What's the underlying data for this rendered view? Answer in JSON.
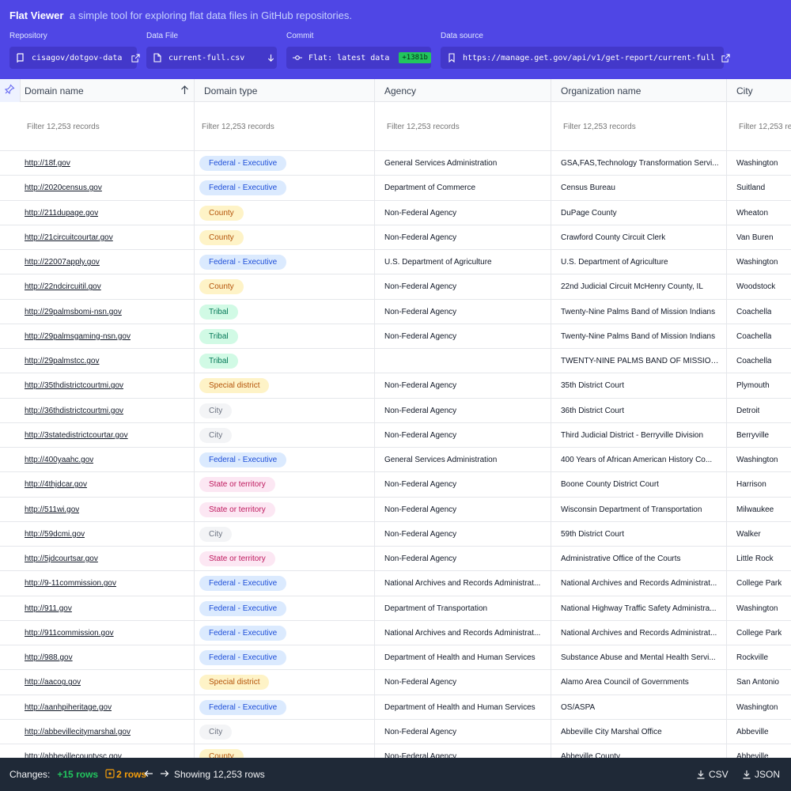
{
  "header": {
    "app_name": "Flat Viewer",
    "tagline": "a simple tool for exploring flat data files in GitHub repositories.",
    "repository": {
      "label": "Repository",
      "value": "cisagov/dotgov-data"
    },
    "data_file": {
      "label": "Data File",
      "value": "current-full.csv"
    },
    "commit": {
      "label": "Commit",
      "value": "Flat: latest data",
      "badge": "+1381b"
    },
    "data_source": {
      "label": "Data source",
      "value": "https://manage.get.gov/api/v1/get-report/current-full"
    }
  },
  "table": {
    "columns": [
      "Domain name",
      "Domain type",
      "Agency",
      "Organization name",
      "City"
    ],
    "filter_placeholder": "Filter 12,253 records",
    "rows": [
      [
        "http://18f.gov",
        "Federal - Executive",
        "General Services Administration",
        "GSA,FAS,Technology Transformation Servi...",
        "Washington"
      ],
      [
        "http://2020census.gov",
        "Federal - Executive",
        "Department of Commerce",
        "Census Bureau",
        "Suitland"
      ],
      [
        "http://211dupage.gov",
        "County",
        "Non-Federal Agency",
        "DuPage County",
        "Wheaton"
      ],
      [
        "http://21circuitcourtar.gov",
        "County",
        "Non-Federal Agency",
        "Crawford County Circuit Clerk",
        "Van Buren"
      ],
      [
        "http://22007apply.gov",
        "Federal - Executive",
        "U.S. Department of Agriculture",
        "U.S. Department of Agriculture",
        "Washington"
      ],
      [
        "http://22ndcircuitil.gov",
        "County",
        "Non-Federal Agency",
        "22nd Judicial Circuit McHenry County, IL",
        "Woodstock"
      ],
      [
        "http://29palmsbomi-nsn.gov",
        "Tribal",
        "Non-Federal Agency",
        "Twenty-Nine Palms Band of Mission Indians",
        "Coachella"
      ],
      [
        "http://29palmsgaming-nsn.gov",
        "Tribal",
        "Non-Federal Agency",
        "Twenty-Nine Palms Band of Mission Indians",
        "Coachella"
      ],
      [
        "http://29palmstcc.gov",
        "Tribal",
        "",
        "TWENTY-NINE PALMS BAND OF MISSION ...",
        "Coachella"
      ],
      [
        "http://35thdistrictcourtmi.gov",
        "Special district",
        "Non-Federal Agency",
        "35th District Court",
        "Plymouth"
      ],
      [
        "http://36thdistrictcourtmi.gov",
        "City",
        "Non-Federal Agency",
        "36th District Court",
        "Detroit"
      ],
      [
        "http://3statedistrictcourtar.gov",
        "City",
        "Non-Federal Agency",
        "Third Judicial District - Berryville Division",
        "Berryville"
      ],
      [
        "http://400yaahc.gov",
        "Federal - Executive",
        "General Services Administration",
        "400 Years of African American History Co...",
        "Washington"
      ],
      [
        "http://4thjdcar.gov",
        "State or territory",
        "Non-Federal Agency",
        "Boone County District Court",
        "Harrison"
      ],
      [
        "http://511wi.gov",
        "State or territory",
        "Non-Federal Agency",
        "Wisconsin Department of Transportation",
        "Milwaukee"
      ],
      [
        "http://59dcmi.gov",
        "City",
        "Non-Federal Agency",
        "59th District Court",
        "Walker"
      ],
      [
        "http://5jdcourtsar.gov",
        "State or territory",
        "Non-Federal Agency",
        "Administrative Office of the Courts",
        "Little Rock"
      ],
      [
        "http://9-11commission.gov",
        "Federal - Executive",
        "National Archives and Records Administrat...",
        "National Archives and Records Administrat...",
        "College Park"
      ],
      [
        "http://911.gov",
        "Federal - Executive",
        "Department of Transportation",
        "National Highway Traffic Safety Administra...",
        "Washington"
      ],
      [
        "http://911commission.gov",
        "Federal - Executive",
        "National Archives and Records Administrat...",
        "National Archives and Records Administrat...",
        "College Park"
      ],
      [
        "http://988.gov",
        "Federal - Executive",
        "Department of Health and Human Services",
        "Substance Abuse and Mental Health Servi...",
        "Rockville"
      ],
      [
        "http://aacog.gov",
        "Special district",
        "Non-Federal Agency",
        "Alamo Area Council of Governments",
        "San Antonio"
      ],
      [
        "http://aanhpiheritage.gov",
        "Federal - Executive",
        "Department of Health and Human Services",
        "OS/ASPA",
        "Washington"
      ],
      [
        "http://abbevillecitymarshal.gov",
        "City",
        "Non-Federal Agency",
        "Abbeville City Marshal Office",
        "Abbeville"
      ],
      [
        "http://abbevillecountysc.gov",
        "County",
        "Non-Federal Agency",
        "Abbeville County",
        "Abbeville"
      ]
    ],
    "type_colors": {
      "Federal - Executive": "t-fed",
      "County": "t-county",
      "Tribal": "t-tribal",
      "Special district": "t-special",
      "City": "t-city",
      "State or territory": "t-state"
    }
  },
  "footer": {
    "changes_label": "Changes:",
    "added": "+15 rows",
    "modified": "2 rows",
    "showing": "Showing 12,253 rows",
    "csv": "CSV",
    "json": "JSON"
  },
  "colors": {
    "header_bg": "#4f46e5",
    "footer_bg": "#1f2937",
    "added": "#22c55e",
    "modified": "#f59e0b"
  }
}
